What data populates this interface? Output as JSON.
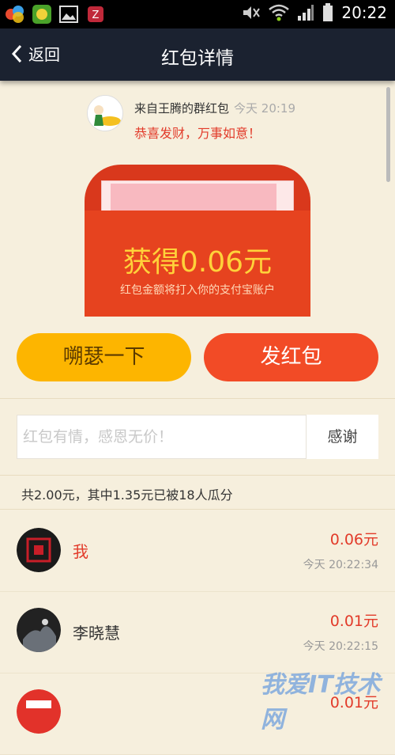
{
  "status_bar": {
    "time": "20:22",
    "icons": [
      "app-icon-1",
      "app-icon-2",
      "gallery-icon",
      "notification-icon",
      "mute-icon",
      "wifi-icon",
      "signal-icon",
      "battery-icon"
    ]
  },
  "nav": {
    "back_label": "返回",
    "title": "红包详情"
  },
  "sender": {
    "name_line": "来自王腾的群红包",
    "time": "今天 20:19",
    "greeting": "恭喜发财，万事如意！"
  },
  "envelope": {
    "amount_text": "获得0.06元",
    "note": "红包金额将打入你的支付宝账户"
  },
  "actions": {
    "shake_label": "嗍瑟一下",
    "send_label": "发红包"
  },
  "thanks": {
    "placeholder": "红包有情，感恩无价！",
    "button_label": "感谢"
  },
  "summary": "共2.00元，其中1.35元已被18人瓜分",
  "claims": [
    {
      "name": "我",
      "amount": "0.06元",
      "time": "今天 20:22:34",
      "name_color": "#e23b2a"
    },
    {
      "name": "李晓慧",
      "amount": "0.01元",
      "time": "今天 20:22:15",
      "name_color": "#333333"
    },
    {
      "name": "",
      "amount": "0.01元",
      "time": "",
      "name_color": "#333333"
    }
  ],
  "watermark": "我爱IT技术网",
  "colors": {
    "title_bar": "#1b2230",
    "accent_red": "#e23b2a",
    "shake_button": "#fdb500",
    "send_button": "#f24b26",
    "envelope": "#e6431f",
    "amount_text": "#ffd23a"
  }
}
